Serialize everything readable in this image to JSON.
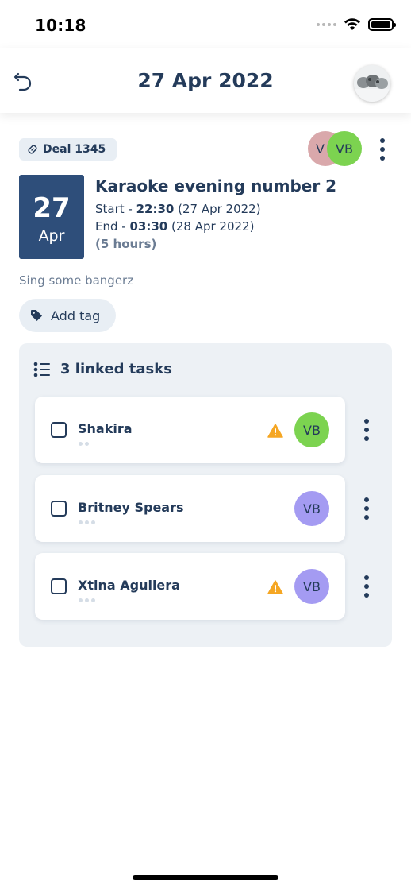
{
  "status_bar": {
    "time": "10:18"
  },
  "header": {
    "title": "27 Apr 2022"
  },
  "deal": {
    "label": "Deal 1345"
  },
  "assignees": [
    {
      "initials": "V",
      "color": "#d9a8ab"
    },
    {
      "initials": "VB",
      "color": "#7cd350"
    }
  ],
  "event": {
    "day": "27",
    "month": "Apr",
    "title": "Karaoke evening number 2",
    "start_prefix": "Start - ",
    "start_time": "22:30",
    "start_date": " (27 Apr 2022)",
    "end_prefix": "End - ",
    "end_time": "03:30",
    "end_date": " (28 Apr 2022)",
    "duration": "(5 hours)",
    "description": "Sing some bangerz"
  },
  "add_tag": {
    "label": "Add tag"
  },
  "tasks": {
    "header": "3 linked tasks",
    "items": [
      {
        "name": "Shakira",
        "warning": true,
        "assignee": "VB",
        "assignee_color": "#7cd350",
        "dots": 2
      },
      {
        "name": "Britney Spears",
        "warning": false,
        "assignee": "VB",
        "assignee_color": "#a49bf2",
        "dots": 3
      },
      {
        "name": "Xtina Aguilera",
        "warning": true,
        "assignee": "VB",
        "assignee_color": "#a49bf2",
        "dots": 3
      }
    ]
  },
  "colors": {
    "primary": "#243b5a",
    "date_block": "#2e4e7a",
    "warning": "#f5a623",
    "panel": "#edf1f5"
  }
}
